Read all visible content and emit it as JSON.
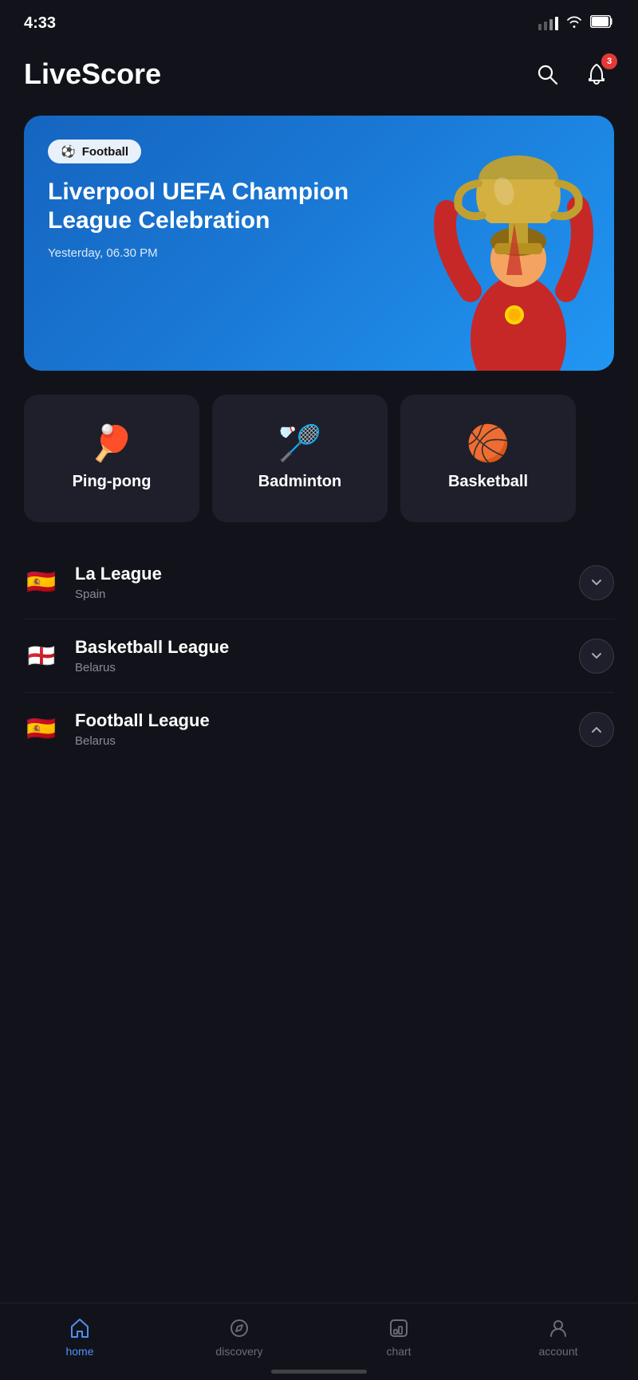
{
  "statusBar": {
    "time": "4:33",
    "notificationCount": "3"
  },
  "header": {
    "title": "LiveScore",
    "searchLabel": "search",
    "notificationLabel": "notifications"
  },
  "heroBanner": {
    "tag": "Football",
    "tagEmoji": "⚽",
    "title": "Liverpool UEFA Champion League Celebration",
    "time": "Yesterday, 06.30 PM"
  },
  "sportsCategories": [
    {
      "id": "ping-pong",
      "emoji": "🏓",
      "label": "Ping-pong"
    },
    {
      "id": "badminton",
      "emoji": "🏸",
      "label": "Badminton"
    },
    {
      "id": "basketball",
      "emoji": "🏀",
      "label": "Basketball"
    }
  ],
  "leagues": [
    {
      "id": "la-league",
      "flag": "🇪🇸",
      "name": "La League",
      "country": "Spain",
      "expanded": false
    },
    {
      "id": "basketball-league",
      "flag": "🏴󠁧󠁢󠁥󠁮󠁧󠁿",
      "name": "Basketball League",
      "country": "Belarus",
      "expanded": false
    },
    {
      "id": "football-league",
      "flag": "🇪🇸",
      "name": "Football League",
      "country": "Belarus",
      "expanded": true
    }
  ],
  "bottomNav": [
    {
      "id": "home",
      "label": "home",
      "icon": "home-icon",
      "active": true
    },
    {
      "id": "discovery",
      "label": "discovery",
      "icon": "compass-icon",
      "active": false
    },
    {
      "id": "chart",
      "label": "chart",
      "icon": "chart-icon",
      "active": false
    },
    {
      "id": "account",
      "label": "account",
      "icon": "person-icon",
      "active": false
    }
  ]
}
